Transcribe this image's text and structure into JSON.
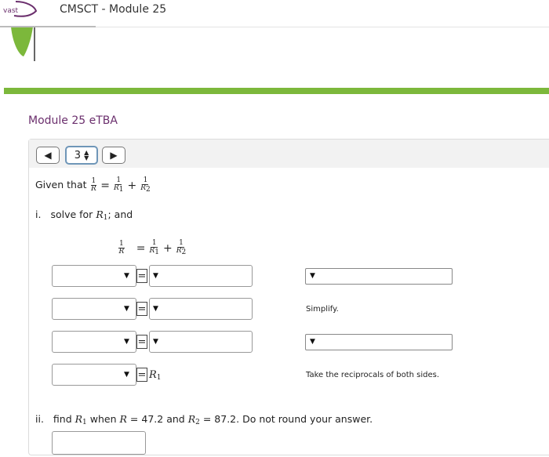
{
  "header": {
    "logo_text": "vast",
    "app_title": "CMSCT - Module 25"
  },
  "module": {
    "title": "Module 25 eTBA"
  },
  "toolbar": {
    "question_number": "3"
  },
  "problem": {
    "given_prefix": "Given that",
    "given_equation": {
      "lhs_den": "R",
      "r1": "R",
      "r1_sub": "1",
      "r2": "R",
      "r2_sub": "2"
    },
    "part_i_label": "i.",
    "part_i_text_pre": "solve for",
    "part_i_var": "R",
    "part_i_var_sub": "1",
    "part_i_text_post": "; and",
    "part_ii_label": "ii.",
    "part_ii_text": "find",
    "part_ii_when": "when",
    "part_ii_eq1": "= 47.2",
    "part_ii_and": "and",
    "part_ii_eq2": "= 87.2.",
    "part_ii_tail": "Do not round your answer."
  },
  "steps": {
    "eq_symbol": "=",
    "result_var": "R",
    "result_sub": "1",
    "notes": [
      "Simplify.",
      "Take the reciprocals of both sides."
    ]
  }
}
